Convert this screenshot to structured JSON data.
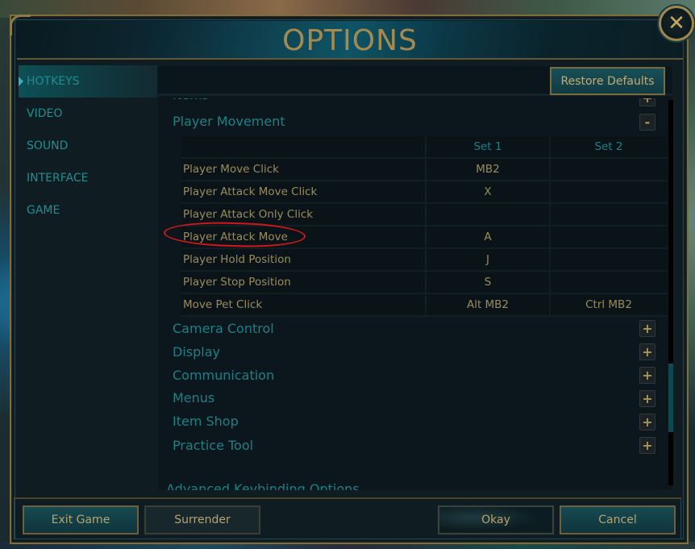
{
  "header": {
    "title": "OPTIONS"
  },
  "close_icon": "close-icon",
  "sidebar": {
    "items": [
      {
        "label": "HOTKEYS",
        "active": true
      },
      {
        "label": "VIDEO",
        "active": false
      },
      {
        "label": "SOUND",
        "active": false
      },
      {
        "label": "INTERFACE",
        "active": false
      },
      {
        "label": "GAME",
        "active": false
      }
    ]
  },
  "toolbar": {
    "restore_defaults_label": "Restore Defaults"
  },
  "sections": {
    "items_partial": {
      "label": "Items",
      "toggle": "+"
    },
    "player_movement": {
      "label": "Player Movement",
      "toggle": "-",
      "columns": [
        "",
        "Set 1",
        "Set 2"
      ],
      "rows": [
        {
          "action": "Player Move Click",
          "set1": "MB2",
          "set2": ""
        },
        {
          "action": "Player Attack Move Click",
          "set1": "X",
          "set2": ""
        },
        {
          "action": "Player Attack Only Click",
          "set1": "",
          "set2": ""
        },
        {
          "action": "Player Attack Move",
          "set1": "A",
          "set2": ""
        },
        {
          "action": "Player Hold Position",
          "set1": "J",
          "set2": ""
        },
        {
          "action": "Player Stop Position",
          "set1": "S",
          "set2": ""
        },
        {
          "action": "Move Pet Click",
          "set1": "Alt MB2",
          "set2": "Ctrl MB2"
        }
      ]
    },
    "collapsed": [
      {
        "label": "Camera Control",
        "toggle": "+"
      },
      {
        "label": "Display",
        "toggle": "+"
      },
      {
        "label": "Communication",
        "toggle": "+"
      },
      {
        "label": "Menus",
        "toggle": "+"
      },
      {
        "label": "Item Shop",
        "toggle": "+"
      },
      {
        "label": "Practice Tool",
        "toggle": "+"
      }
    ],
    "advanced_partial": {
      "label": "Advanced Keybinding Options"
    }
  },
  "annotation": {
    "highlighted_row": "Player Attack Move",
    "color": "#d01818"
  },
  "footer": {
    "exit_label": "Exit Game",
    "surrender_label": "Surrender",
    "okay_label": "Okay",
    "cancel_label": "Cancel"
  },
  "colors": {
    "accent_gold": "#a48a4e",
    "accent_teal": "#1d8088",
    "text_gold": "#9a8c5c"
  }
}
